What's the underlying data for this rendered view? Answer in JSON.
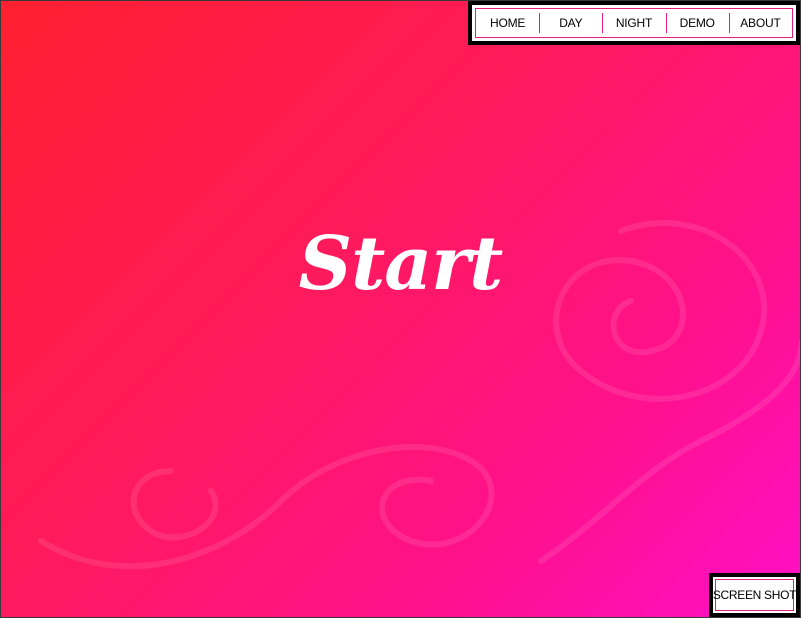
{
  "nav": {
    "items": [
      {
        "label": "HOME"
      },
      {
        "label": "DAY"
      },
      {
        "label": "NIGHT"
      },
      {
        "label": "DEMO"
      },
      {
        "label": "ABOUT"
      }
    ]
  },
  "main": {
    "title": "Start"
  },
  "footer": {
    "screenshot_label": "SCREEN SHOT"
  },
  "colors": {
    "gradient_start": "#ff2030",
    "gradient_end": "#ff10c8",
    "accent": "#e0207a",
    "frame": "#000000"
  }
}
